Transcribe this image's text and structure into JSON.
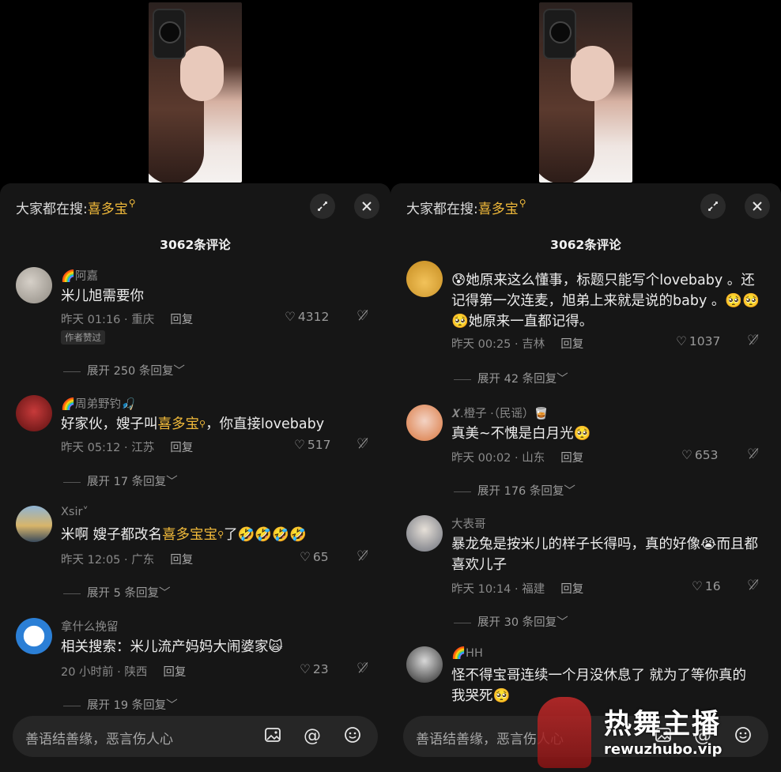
{
  "colors": {
    "highlight": "#f0b93a",
    "panel_bg": "#161616"
  },
  "left": {
    "search_prefix": "大家都在搜:",
    "search_term": "喜多宝",
    "comment_count": "3062条评论",
    "comments": [
      {
        "user": "🌈阿嘉",
        "text": "米儿旭需要你",
        "meta": "昨天 01:16 · 重庆",
        "reply": "回复",
        "likes": "4312",
        "badge": "作者赞过",
        "expand": "展开 250 条回复"
      },
      {
        "user": "🌈周弟野钓🎣",
        "text_a": "好家伙，嫂子叫",
        "text_hl": "喜多宝",
        "text_b": "，你直接lovebaby",
        "meta": "昨天 05:12 · 江苏",
        "reply": "回复",
        "likes": "517",
        "expand": "展开 17 条回复"
      },
      {
        "user": "Xsir˅",
        "text_a": "米啊  嫂子都改名",
        "text_hl": "喜多宝宝",
        "text_b": "了🤣🤣🤣🤣",
        "meta": "昨天 12:05 · 广东",
        "reply": "回复",
        "likes": "65",
        "expand": "展开 5 条回复"
      },
      {
        "user": "拿什么挽留",
        "text": "相关搜索：米儿流产妈妈大闹婆家🙀",
        "meta": "20 小时前 · 陕西",
        "reply": "回复",
        "likes": "23",
        "expand": "展开 19 条回复"
      }
    ],
    "input_placeholder": "善语结善缘，恶言伤人心"
  },
  "right": {
    "search_prefix": "大家都在搜:",
    "search_term": "喜多宝",
    "comment_count": "3062条评论",
    "comments": [
      {
        "text": "😰她原来这么懂事，标题只能写个lovebaby 。还记得第一次连麦，旭弟上来就是说的baby 。🥺🥺🥺她原来一直都记得。",
        "meta": "昨天 00:25 · 吉林",
        "reply": "回复",
        "likes": "1037",
        "expand": "展开 42 条回复"
      },
      {
        "user": "𝑿.橙子 ·（民谣）🥃",
        "text": "真美~不愧是白月光🥺",
        "meta": "昨天 00:02 · 山东",
        "reply": "回复",
        "likes": "653",
        "expand": "展开 176 条回复"
      },
      {
        "user": "大表哥",
        "text": "暴龙兔是按米儿的样子长得吗，真的好像😭而且都喜欢儿子",
        "meta": "昨天 10:14 · 福建",
        "reply": "回复",
        "likes": "16",
        "expand": "展开 30 条回复"
      },
      {
        "user": "🌈HH",
        "text": "怪不得宝哥连续一个月没休息了  就为了等你真的  我哭死🥺"
      }
    ],
    "input_placeholder": "善语结善缘，恶言伤人心"
  },
  "watermark": {
    "title": "热舞主播",
    "url": "rewuzhubo.vip"
  }
}
